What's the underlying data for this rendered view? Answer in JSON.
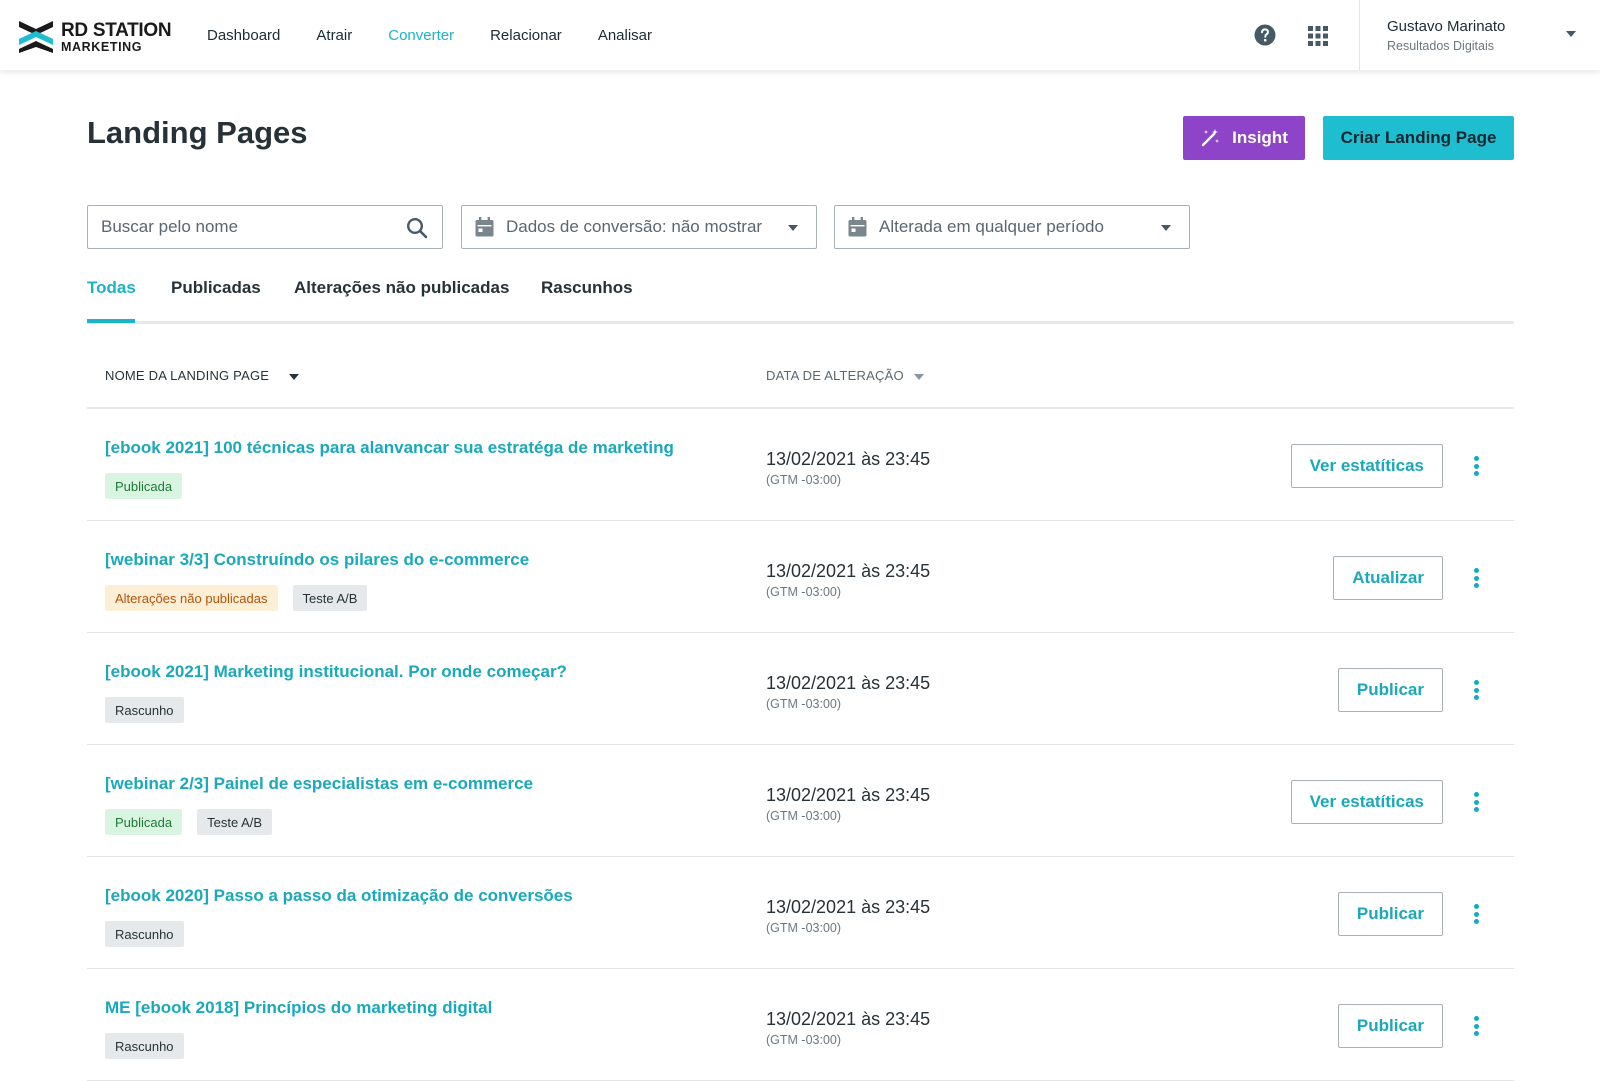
{
  "brand": {
    "line1": "RD STATION",
    "line2": "MARKETING"
  },
  "nav": {
    "items": [
      {
        "label": "Dashboard",
        "active": false
      },
      {
        "label": "Atrair",
        "active": false
      },
      {
        "label": "Converter",
        "active": true
      },
      {
        "label": "Relacionar",
        "active": false
      },
      {
        "label": "Analisar",
        "active": false
      }
    ]
  },
  "user": {
    "name": "Gustavo Marinato",
    "org": "Resultados Digitais"
  },
  "page": {
    "title": "Landing Pages",
    "insight_label": "Insight",
    "create_label": "Criar Landing Page"
  },
  "filters": {
    "search_placeholder": "Buscar pelo nome",
    "conversion_value": "Dados de conversão: não mostrar",
    "period_value": "Alterada em qualquer período"
  },
  "tabs": [
    {
      "label": "Todas",
      "active": true
    },
    {
      "label": "Publicadas",
      "active": false
    },
    {
      "label": "Alterações não publicadas",
      "active": false
    },
    {
      "label": "Rascunhos",
      "active": false
    }
  ],
  "table": {
    "col_name": "NOME DA LANDING PAGE",
    "col_date": "DATA DE ALTERAÇÃO",
    "rows": [
      {
        "title": "[ebook 2021] 100 técnicas para alanvancar sua estratéga de marketing",
        "badges": [
          {
            "label": "Publicada",
            "type": "pub"
          }
        ],
        "date": "13/02/2021 às 23:45",
        "tz": "(GTM -03:00)",
        "action": "Ver estatíticas"
      },
      {
        "title": "[webinar 3/3] Construíndo os pilares do e-commerce",
        "badges": [
          {
            "label": "Alterações não publicadas",
            "type": "unpub"
          },
          {
            "label": "Teste A/B",
            "type": "ab"
          }
        ],
        "date": "13/02/2021 às 23:45",
        "tz": "(GTM -03:00)",
        "action": "Atualizar"
      },
      {
        "title": "[ebook 2021] Marketing institucional. Por onde começar?",
        "badges": [
          {
            "label": "Rascunho",
            "type": "draft"
          }
        ],
        "date": "13/02/2021 às 23:45",
        "tz": "(GTM -03:00)",
        "action": "Publicar"
      },
      {
        "title": "[webinar 2/3] Painel de especialistas em e-commerce",
        "badges": [
          {
            "label": "Publicada",
            "type": "pub"
          },
          {
            "label": "Teste A/B",
            "type": "ab"
          }
        ],
        "date": "13/02/2021 às 23:45",
        "tz": "(GTM -03:00)",
        "action": "Ver estatíticas"
      },
      {
        "title": "[ebook 2020] Passo a passo da otimização de conversões",
        "badges": [
          {
            "label": "Rascunho",
            "type": "draft"
          }
        ],
        "date": "13/02/2021 às 23:45",
        "tz": "(GTM -03:00)",
        "action": "Publicar"
      },
      {
        "title": "ME [ebook 2018] Princípios do marketing digital",
        "badges": [
          {
            "label": "Rascunho",
            "type": "draft"
          }
        ],
        "date": "13/02/2021 às 23:45",
        "tz": "(GTM -03:00)",
        "action": "Publicar"
      }
    ]
  },
  "colors": {
    "accent": "#19b4c8",
    "insight": "#8e44c8",
    "create": "#1fbdd0"
  }
}
